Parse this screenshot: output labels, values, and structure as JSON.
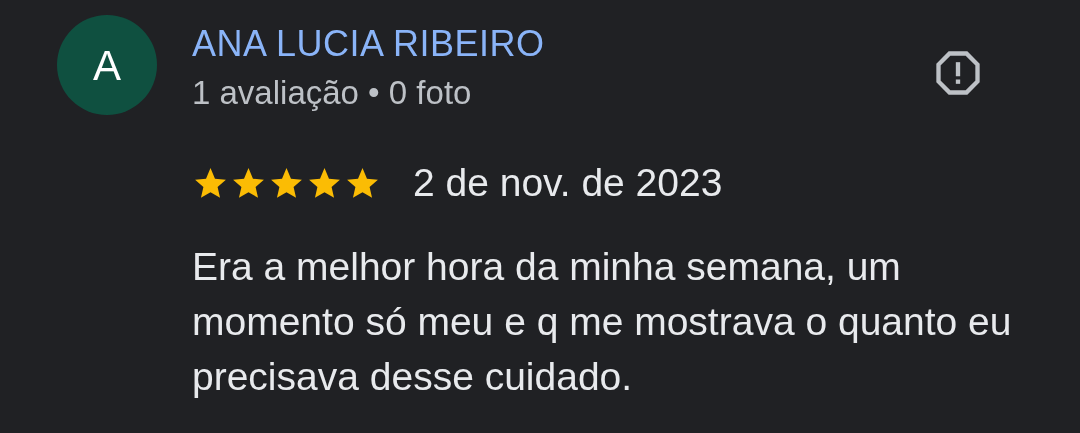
{
  "review": {
    "avatar_letter": "A",
    "author": "ANA LUCIA RIBEIRO",
    "author_meta": "1 avaliação • 0 foto",
    "stars": 5,
    "date": "2 de nov. de 2023",
    "text": "Era a melhor hora da minha semana, um momento só meu e q me mostrava o quanto eu precisava desse cuidado."
  }
}
